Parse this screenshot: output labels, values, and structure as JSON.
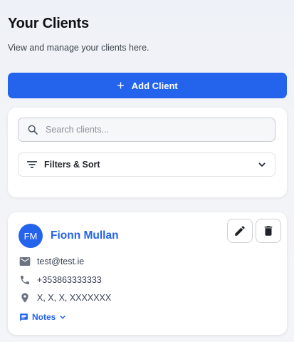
{
  "header": {
    "title": "Your Clients",
    "subtitle": "View and manage your clients here."
  },
  "actions": {
    "add_client_label": "Add Client"
  },
  "search": {
    "placeholder": "Search clients...",
    "value": ""
  },
  "filters": {
    "label": "Filters & Sort"
  },
  "clients": [
    {
      "initials": "FM",
      "name": "Fionn Mullan",
      "email": "test@test.ie",
      "phone": "+353863333333",
      "address": "X, X, X, XXXXXXX",
      "notes_label": "Notes"
    }
  ],
  "icons": {
    "add": "plus-icon",
    "search": "search-icon",
    "filter": "filter-icon",
    "dropdown": "chevron-down-icon",
    "edit": "pencil-icon",
    "delete": "trash-icon",
    "email": "mail-icon",
    "phone": "phone-icon",
    "address": "location-pin-icon",
    "notes": "notes-icon"
  },
  "colors": {
    "accent": "#2463eb",
    "icon_gray": "#6b7280",
    "text_dark": "#0f1115"
  }
}
